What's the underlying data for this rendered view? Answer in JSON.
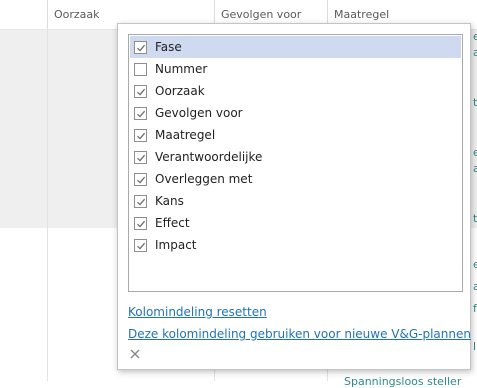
{
  "grid": {
    "columns": [
      "Oorzaak",
      "Gevolgen voor",
      "Maatregel"
    ],
    "peek_chars": [
      "e",
      "a",
      "",
      "t",
      "",
      "e",
      "a",
      "",
      "t",
      "",
      "e",
      "",
      "",
      "a",
      "",
      "l",
      "f",
      "l"
    ],
    "bottom_peek": "Spanningsloos steller"
  },
  "column_picker": {
    "items": [
      {
        "label": "Fase",
        "checked": true
      },
      {
        "label": "Nummer",
        "checked": false
      },
      {
        "label": "Oorzaak",
        "checked": true
      },
      {
        "label": "Gevolgen voor",
        "checked": true
      },
      {
        "label": "Maatregel",
        "checked": true
      },
      {
        "label": "Verantwoordelijke",
        "checked": true
      },
      {
        "label": "Overleggen met",
        "checked": true
      },
      {
        "label": "Kans",
        "checked": true
      },
      {
        "label": "Effect",
        "checked": true
      },
      {
        "label": "Impact",
        "checked": true
      }
    ],
    "reset_link": "Kolomindeling resetten",
    "use_default_link": "Deze kolomindeling gebruiken voor nieuwe V&G-plannen",
    "close_icon": "close-icon"
  },
  "colors": {
    "accent_link": "#1f72b8",
    "selected_item": "#cfdaf0",
    "peek_text": "#2e8a8a"
  }
}
